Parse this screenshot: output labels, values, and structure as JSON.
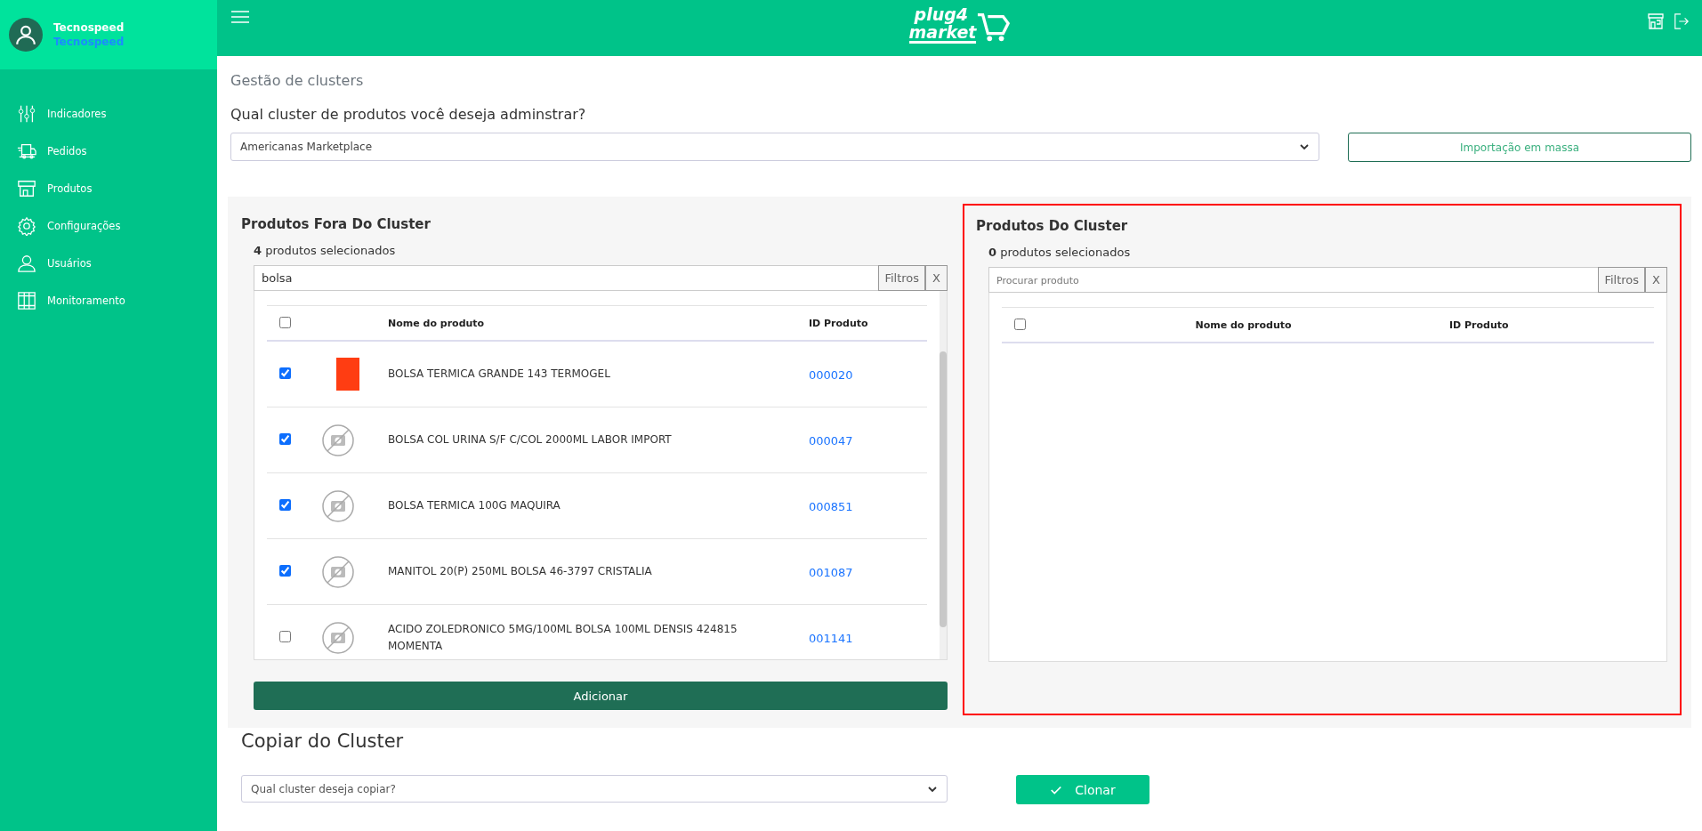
{
  "sidebar": {
    "user": {
      "name": "Tecnospeed",
      "company": "Tecnospeed"
    },
    "items": [
      {
        "label": "Indicadores"
      },
      {
        "label": "Pedidos"
      },
      {
        "label": "Produtos"
      },
      {
        "label": "Configurações"
      },
      {
        "label": "Usuários"
      },
      {
        "label": "Monitoramento"
      }
    ]
  },
  "header": {
    "logo_lines": [
      "plug4",
      "market"
    ]
  },
  "page": {
    "title": "Gestão de clusters",
    "question": "Qual cluster de produtos você deseja adminstrar?",
    "cluster_select": "Americanas Marketplace",
    "import_button": "Importação em massa"
  },
  "left_panel": {
    "title": "Produtos Fora Do Cluster",
    "selected_count": "**4** produtos selecionados",
    "search": {
      "value": "bolsa"
    },
    "filter_button": "Filtros",
    "clear_button": "X",
    "columns": [
      "Nome do produto",
      "ID Produto"
    ],
    "header_checked": false,
    "rows": [
      {
        "checked": true,
        "kind": "photo",
        "name": "BOLSA TERMICA GRANDE 143 TERMOGEL",
        "id": "000020"
      },
      {
        "checked": true,
        "kind": "placeholder",
        "name": "BOLSA COL URINA S/F C/COL 2000ML LABOR IMPORT",
        "id": "000047"
      },
      {
        "checked": true,
        "kind": "placeholder",
        "name": "BOLSA TERMICA 100G MAQUIRA",
        "id": "000851"
      },
      {
        "checked": true,
        "kind": "placeholder",
        "name": "MANITOL 20(P) 250ML BOLSA 46-3797 CRISTALIA",
        "id": "001087"
      },
      {
        "checked": false,
        "kind": "placeholder",
        "name": "ACIDO ZOLEDRONICO 5MG/100ML BOLSA 100ML DENSIS 424815 MOMENTA",
        "id": "001141"
      }
    ],
    "add_button": "Adicionar"
  },
  "right_panel": {
    "title": "Produtos Do Cluster",
    "highlighted": true,
    "selected_count": "**0** produtos selecionados",
    "search": {
      "placeholder": "Procurar produto"
    },
    "filter_button": "Filtros",
    "clear_button": "X",
    "columns": [
      "Nome do produto",
      "ID Produto"
    ],
    "header_checked": false
  },
  "copy": {
    "title": "Copiar do Cluster",
    "select_placeholder": "Qual cluster deseja copiar?",
    "clone_button": "Clonar"
  }
}
